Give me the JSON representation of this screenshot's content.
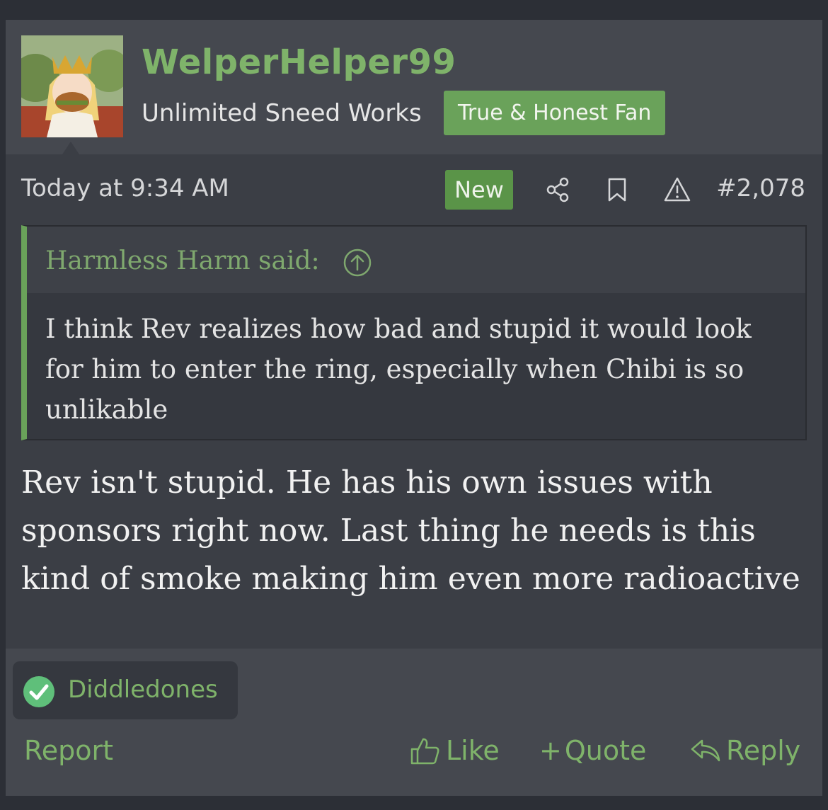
{
  "post": {
    "username": "WelperHelper99",
    "user_title": "Unlimited Sneed Works",
    "banner": "True & Honest Fan",
    "date": "Today at 9:34 AM",
    "new_badge": "New",
    "post_number": "#2,078",
    "quote": {
      "author_line": "Harmless Harm said:",
      "text": "I think Rev realizes how bad and stupid it would look for him to enter the ring, especially when Chibi is so unlikable"
    },
    "message": "Rev isn't stupid. He has his own issues with sponsors right now. Last thing he needs is this kind of smoke making him even more radioactive"
  },
  "reactions": [
    {
      "icon": "check-circle-icon",
      "user": "Diddledones"
    }
  ],
  "actions": {
    "report": "Report",
    "like": "Like",
    "quote_plus": "+",
    "quote": "Quote",
    "reply": "Reply"
  },
  "colors": {
    "accent": "#7fb36a",
    "banner": "#6aa25a",
    "background": "#3b3e45"
  }
}
